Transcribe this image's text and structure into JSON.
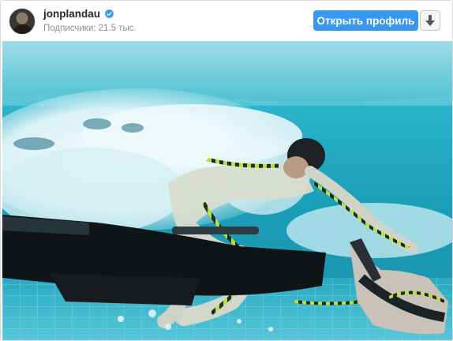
{
  "post": {
    "username": "jonplandau",
    "followers_text": "Подписчики: 21.5 тыс.",
    "verified": true,
    "open_profile_label": "Открыть профиль",
    "download_icon": "arrow-down-icon",
    "verified_icon": "verified-badge-icon",
    "accent_color": "#3897f0"
  },
  "photo": {
    "subject": "underwater-performance-capture-photo"
  }
}
